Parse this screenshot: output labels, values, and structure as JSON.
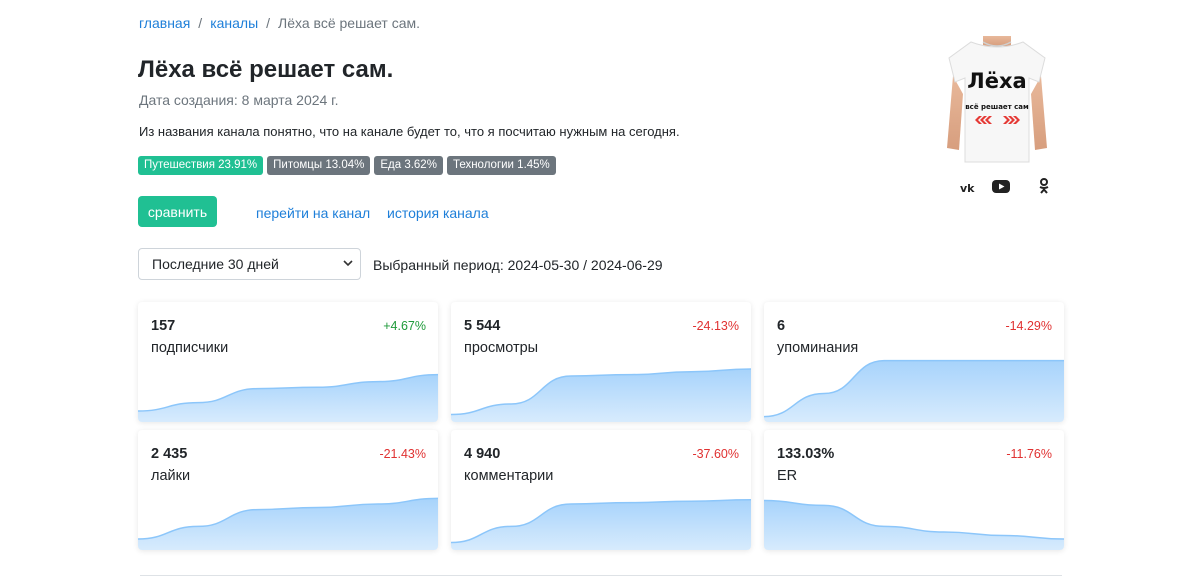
{
  "breadcrumb": {
    "home": "главная",
    "sep1": "/",
    "channels": "каналы",
    "sep2": "/",
    "current": "Лёха всё решает сам."
  },
  "channel": {
    "title": "Лёха всё решает сам.",
    "created": "Дата создания: 8 марта 2024 г.",
    "description": "Из названия канала понятно, что на канале будет то, что я посчитаю нужным на сегодня.",
    "avatar_text": {
      "line1": "Лёха",
      "line2": "всё решает сам"
    }
  },
  "tags": [
    {
      "label": "Путешествия 23.91%",
      "color": "#20c093"
    },
    {
      "label": "Питомцы 13.04%",
      "color": "#6c757d"
    },
    {
      "label": "Еда 3.62%",
      "color": "#6c757d"
    },
    {
      "label": "Технологии 1.45%",
      "color": "#6c757d"
    }
  ],
  "actions": {
    "compare": "сравнить",
    "goto_channel": "перейти на канал",
    "history": "история канала"
  },
  "period": {
    "select_value": "Последние 30 дней",
    "selected": "Выбранный период: 2024-05-30 / 2024-06-29"
  },
  "socials": {
    "vk": "vk-icon",
    "youtube": "youtube-icon",
    "ok": "odnoklassniki-icon"
  },
  "colors": {
    "accent": "#20c093",
    "link": "#1e7fd9",
    "positive": "#1f9a3a",
    "negative": "#e03131",
    "spark_fill": "#a7d3fb"
  },
  "metrics": [
    {
      "value": "157",
      "label": "подписчики",
      "change": "+4.67%",
      "trend": "pos",
      "spark": [
        0.1,
        0.22,
        0.42,
        0.44,
        0.52,
        0.62
      ]
    },
    {
      "value": "5 544",
      "label": "просмотры",
      "change": "-24.13%",
      "trend": "neg",
      "spark": [
        0.05,
        0.2,
        0.6,
        0.62,
        0.66,
        0.7
      ]
    },
    {
      "value": "6",
      "label": "упоминания",
      "change": "-14.29%",
      "trend": "neg",
      "spark": [
        0.02,
        0.35,
        0.82,
        0.82,
        0.82,
        0.82
      ]
    },
    {
      "value": "2 435",
      "label": "лайки",
      "change": "-21.43%",
      "trend": "neg",
      "spark": [
        0.1,
        0.28,
        0.52,
        0.55,
        0.6,
        0.68
      ]
    },
    {
      "value": "4 940",
      "label": "комментарии",
      "change": "-37.60%",
      "trend": "neg",
      "spark": [
        0.05,
        0.28,
        0.6,
        0.62,
        0.64,
        0.66
      ]
    },
    {
      "value": "133.03%",
      "label": "ER",
      "change": "-11.76%",
      "trend": "neg",
      "spark": [
        0.65,
        0.58,
        0.28,
        0.2,
        0.15,
        0.1
      ]
    }
  ]
}
